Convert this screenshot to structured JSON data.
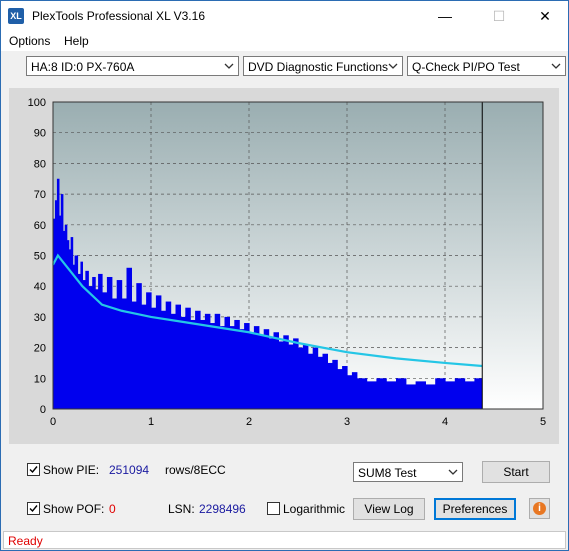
{
  "window": {
    "icon_text": "XL",
    "title": "PlexTools Professional XL V3.16",
    "minimize_glyph": "—",
    "maximize_glyph": "☐",
    "close_glyph": "✕"
  },
  "menu": {
    "options": "Options",
    "help": "Help"
  },
  "toolbar": {
    "drive": "HA:8 ID:0  PX-760A",
    "function": "DVD Diagnostic Functions",
    "test": "Q-Check PI/PO Test"
  },
  "chart_data": {
    "type": "area",
    "xlim": [
      0,
      5
    ],
    "ylim": [
      0,
      100
    ],
    "x_ticks": [
      "0",
      "1",
      "2",
      "3",
      "4",
      "5"
    ],
    "y_ticks": [
      "0",
      "10",
      "20",
      "30",
      "40",
      "50",
      "60",
      "70",
      "80",
      "90",
      "100"
    ],
    "grid": true,
    "scan_end_x": 4.38,
    "colors": {
      "plot_top": "#9aaeb1",
      "plot_bottom": "#ffffff",
      "pie_fill": "#0000ee",
      "pie_line": "#24c6e6",
      "gridline": "#555555"
    },
    "series": [
      {
        "kind": "pie_bars",
        "points": [
          [
            0.0,
            62
          ],
          [
            0.02,
            68
          ],
          [
            0.04,
            75
          ],
          [
            0.06,
            63
          ],
          [
            0.08,
            70
          ],
          [
            0.1,
            58
          ],
          [
            0.12,
            60
          ],
          [
            0.14,
            55
          ],
          [
            0.16,
            52
          ],
          [
            0.18,
            56
          ],
          [
            0.2,
            47
          ],
          [
            0.22,
            50
          ],
          [
            0.25,
            44
          ],
          [
            0.28,
            48
          ],
          [
            0.3,
            42
          ],
          [
            0.33,
            45
          ],
          [
            0.36,
            40
          ],
          [
            0.4,
            43
          ],
          [
            0.43,
            39
          ],
          [
            0.46,
            44
          ],
          [
            0.5,
            38
          ],
          [
            0.55,
            43
          ],
          [
            0.6,
            36
          ],
          [
            0.65,
            42
          ],
          [
            0.7,
            36
          ],
          [
            0.75,
            46
          ],
          [
            0.8,
            35
          ],
          [
            0.85,
            41
          ],
          [
            0.9,
            34
          ],
          [
            0.95,
            38
          ],
          [
            1.0,
            33
          ],
          [
            1.05,
            37
          ],
          [
            1.1,
            32
          ],
          [
            1.15,
            35
          ],
          [
            1.2,
            31
          ],
          [
            1.25,
            34
          ],
          [
            1.3,
            30
          ],
          [
            1.35,
            33
          ],
          [
            1.4,
            29
          ],
          [
            1.45,
            32
          ],
          [
            1.5,
            29
          ],
          [
            1.55,
            31
          ],
          [
            1.6,
            28
          ],
          [
            1.65,
            31
          ],
          [
            1.7,
            27
          ],
          [
            1.75,
            30
          ],
          [
            1.8,
            27
          ],
          [
            1.85,
            29
          ],
          [
            1.9,
            26
          ],
          [
            1.95,
            28
          ],
          [
            2.0,
            25
          ],
          [
            2.05,
            27
          ],
          [
            2.1,
            24
          ],
          [
            2.15,
            26
          ],
          [
            2.2,
            23
          ],
          [
            2.25,
            25
          ],
          [
            2.3,
            22
          ],
          [
            2.35,
            24
          ],
          [
            2.4,
            21
          ],
          [
            2.45,
            23
          ],
          [
            2.5,
            20
          ],
          [
            2.55,
            21
          ],
          [
            2.6,
            18
          ],
          [
            2.65,
            20
          ],
          [
            2.7,
            17
          ],
          [
            2.75,
            18
          ],
          [
            2.8,
            15
          ],
          [
            2.85,
            16
          ],
          [
            2.9,
            13
          ],
          [
            2.95,
            14
          ],
          [
            3.0,
            11
          ],
          [
            3.05,
            12
          ],
          [
            3.1,
            10
          ],
          [
            3.15,
            10
          ],
          [
            3.2,
            9
          ],
          [
            3.3,
            10
          ],
          [
            3.4,
            9
          ],
          [
            3.5,
            10
          ],
          [
            3.6,
            8
          ],
          [
            3.7,
            9
          ],
          [
            3.8,
            8
          ],
          [
            3.9,
            10
          ],
          [
            4.0,
            9
          ],
          [
            4.1,
            10
          ],
          [
            4.2,
            9
          ],
          [
            4.3,
            10
          ],
          [
            4.38,
            9
          ]
        ]
      },
      {
        "kind": "pie_average",
        "points": [
          [
            0.0,
            47
          ],
          [
            0.05,
            50
          ],
          [
            0.1,
            48
          ],
          [
            0.2,
            44
          ],
          [
            0.3,
            40
          ],
          [
            0.4,
            37
          ],
          [
            0.5,
            34
          ],
          [
            0.7,
            32
          ],
          [
            1.0,
            30
          ],
          [
            1.3,
            28.5
          ],
          [
            1.6,
            27
          ],
          [
            2.0,
            25
          ],
          [
            2.5,
            21.5
          ],
          [
            3.0,
            18.5
          ],
          [
            3.5,
            16.5
          ],
          [
            4.0,
            15
          ],
          [
            4.38,
            14
          ]
        ]
      }
    ]
  },
  "bottom": {
    "show_pie_label": "Show PIE:",
    "pie_value": "251094",
    "rows_label": "rows/8ECC",
    "show_pof_label": "Show POF:",
    "pof_value": "0",
    "lsn_label": "LSN:",
    "lsn_value": "2298496",
    "log_label": "Logarithmic",
    "test_select": "SUM8 Test",
    "start_button": "Start",
    "view_log_button": "View Log",
    "preferences_button": "Preferences",
    "info_glyph": "i",
    "pie_checked": true,
    "pof_checked": true,
    "log_checked": false
  },
  "status": {
    "text": "Ready"
  }
}
